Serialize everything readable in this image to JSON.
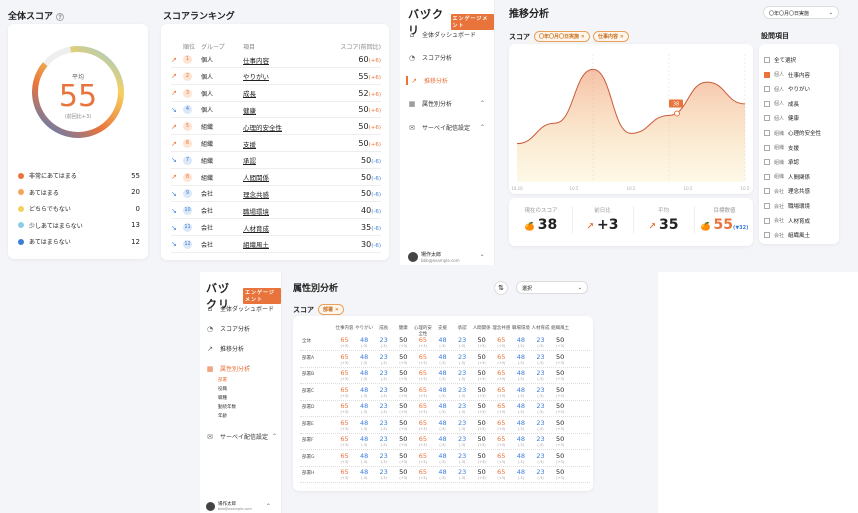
{
  "overall": {
    "title": "全体スコア",
    "avg_label": "平均",
    "avg_value": "55",
    "prev": "(前回比+3)",
    "legend": [
      {
        "label": "非常にあてはまる",
        "value": "55",
        "color": "#e8743c"
      },
      {
        "label": "あてはまる",
        "value": "20",
        "color": "#f2a65a"
      },
      {
        "label": "どちらでもない",
        "value": "0",
        "color": "#f5d05e"
      },
      {
        "label": "少しあてはまらない",
        "value": "13",
        "color": "#8ecbe6"
      },
      {
        "label": "あてはまらない",
        "value": "12",
        "color": "#3b7ed6"
      }
    ]
  },
  "ranking": {
    "title": "スコアランキング",
    "headers": [
      "順位",
      "グループ",
      "項目",
      "スコア(前回比)"
    ],
    "rows": [
      {
        "dir": "up",
        "rank": "1",
        "group": "個人",
        "item": "仕事内容",
        "score": "60",
        "chg": "(+6)"
      },
      {
        "dir": "up",
        "rank": "2",
        "group": "個人",
        "item": "やりがい",
        "score": "55",
        "chg": "(+6)"
      },
      {
        "dir": "up",
        "rank": "3",
        "group": "個人",
        "item": "成長",
        "score": "52",
        "chg": "(+6)"
      },
      {
        "dir": "dn",
        "rank": "4",
        "group": "個人",
        "item": "健康",
        "score": "50",
        "chg": "(+6)"
      },
      {
        "dir": "up",
        "rank": "5",
        "group": "組織",
        "item": "心理的安全性",
        "score": "50",
        "chg": "(+6)"
      },
      {
        "dir": "up",
        "rank": "6",
        "group": "組織",
        "item": "支援",
        "score": "50",
        "chg": "(+6)"
      },
      {
        "dir": "dn",
        "rank": "7",
        "group": "組織",
        "item": "承認",
        "score": "50",
        "chg": "(-6)"
      },
      {
        "dir": "up",
        "rank": "8",
        "group": "組織",
        "item": "人間関係",
        "score": "50",
        "chg": "(-6)"
      },
      {
        "dir": "dn",
        "rank": "9",
        "group": "会社",
        "item": "理念共感",
        "score": "50",
        "chg": "(-6)"
      },
      {
        "dir": "dn",
        "rank": "10",
        "group": "会社",
        "item": "職場環境",
        "score": "40",
        "chg": "(-6)"
      },
      {
        "dir": "dn",
        "rank": "11",
        "group": "会社",
        "item": "人材育成",
        "score": "35",
        "chg": "(-6)"
      },
      {
        "dir": "dn",
        "rank": "12",
        "group": "会社",
        "item": "組織風土",
        "score": "30",
        "chg": "(-6)"
      }
    ]
  },
  "app": {
    "logo": "バヅクリ",
    "logo_badge": "エンゲージメント",
    "nav": [
      "全体ダッシュボード",
      "スコア分析",
      "推移分析",
      "属性別分析",
      "サーベイ配信設定"
    ],
    "user_name": "場作太郎",
    "user_email": "bbb@example.com"
  },
  "trend": {
    "title": "推移分析",
    "date_select": "〇年〇月〇日実施",
    "score_label": "スコア",
    "tags": [
      "〇年〇月〇日実施",
      "仕事内容"
    ],
    "tooltip": "38",
    "x_ticks": [
      "10.10",
      "10.5",
      "10.5",
      "10.5",
      "10.5"
    ],
    "stats": [
      {
        "label": "現在のスコア",
        "value": "38",
        "icon": "🍊"
      },
      {
        "label": "前日比",
        "value": "+3",
        "icon": "↗"
      },
      {
        "label": "平均",
        "value": "35",
        "icon": "↗"
      },
      {
        "label": "目標数値",
        "value": "55",
        "icon": "🍊",
        "sub": "(▼32)"
      }
    ],
    "q_title": "設問項目",
    "q_items": [
      {
        "g": "",
        "l": "全て選択",
        "on": false
      },
      {
        "g": "個人",
        "l": "仕事内容",
        "on": true
      },
      {
        "g": "個人",
        "l": "やりがい",
        "on": false
      },
      {
        "g": "個人",
        "l": "成長",
        "on": false
      },
      {
        "g": "個人",
        "l": "健康",
        "on": false
      },
      {
        "g": "組織",
        "l": "心理的安全性",
        "on": false
      },
      {
        "g": "組織",
        "l": "支援",
        "on": false
      },
      {
        "g": "組織",
        "l": "承認",
        "on": false
      },
      {
        "g": "組織",
        "l": "人間関係",
        "on": false
      },
      {
        "g": "会社",
        "l": "理念共感",
        "on": false
      },
      {
        "g": "会社",
        "l": "職場環境",
        "on": false
      },
      {
        "g": "会社",
        "l": "人材育成",
        "on": false
      },
      {
        "g": "会社",
        "l": "組織風土",
        "on": false
      }
    ]
  },
  "attr": {
    "title": "属性別分析",
    "select": "選択",
    "score_label": "スコア",
    "tag": "部署",
    "sub_nav": [
      "部署",
      "役職",
      "職種",
      "勤続年数",
      "年齢"
    ],
    "columns": [
      "仕事内容",
      "やりがい",
      "成長",
      "健康",
      "心理的安全性",
      "支援",
      "承認",
      "人間関係",
      "理念共感",
      "職場環境",
      "人材育成",
      "組織風土"
    ],
    "rows": [
      "全体",
      "部署A",
      "部署B",
      "部署C",
      "部署D",
      "部署E",
      "部署F",
      "部署G",
      "部署H"
    ],
    "values": [
      "65",
      "48",
      "23",
      "50",
      "65",
      "48",
      "23",
      "50",
      "65",
      "48",
      "23",
      "50"
    ],
    "subs": [
      "(+3)",
      "(-3)",
      "(-3)",
      "(+3)",
      "(+3)",
      "(-3)",
      "(-3)",
      "(+3)",
      "(+3)",
      "(-3)",
      "(-3)",
      "(+3)"
    ]
  },
  "trend_chart": {
    "type": "area",
    "x": [
      "10.10",
      "10.5",
      "10.5",
      "10.5",
      "10.5"
    ],
    "values": [
      30,
      46,
      88,
      38,
      52,
      78,
      61
    ],
    "ylim": [
      0,
      100
    ]
  }
}
